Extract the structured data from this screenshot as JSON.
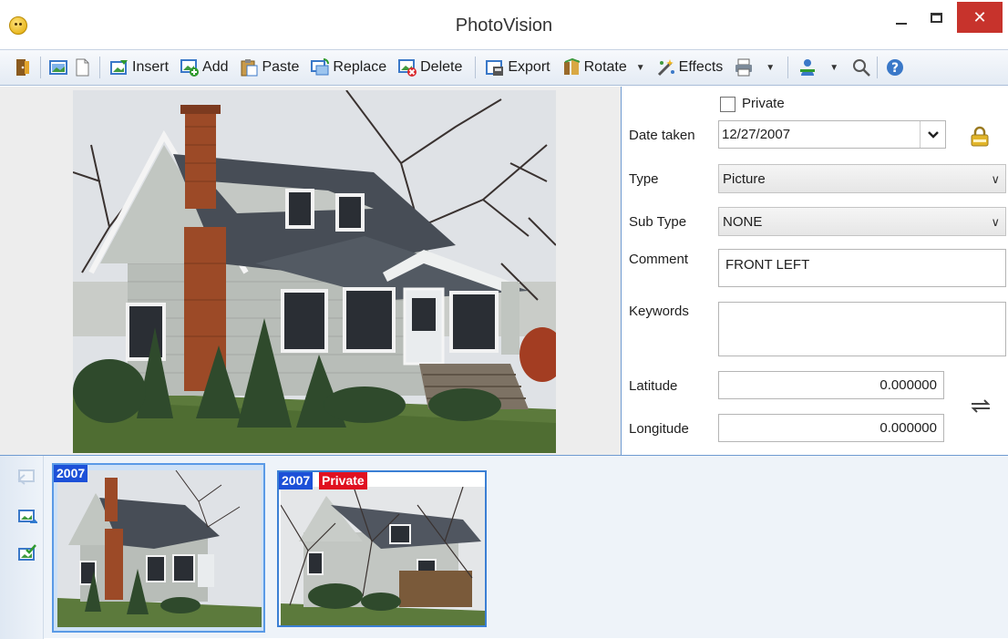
{
  "window": {
    "title": "PhotoVision",
    "close_glyph": "✕"
  },
  "toolbar": {
    "items": [
      {
        "icon": "exit-icon"
      },
      {
        "icon": "picture-icon"
      },
      {
        "icon": "page-icon"
      },
      {
        "label": "Insert",
        "icon": "insert-icon"
      },
      {
        "label": "Add",
        "icon": "add-icon"
      },
      {
        "label": "Paste",
        "icon": "paste-icon"
      },
      {
        "label": "Replace",
        "icon": "replace-icon"
      },
      {
        "label": "Delete",
        "icon": "delete-icon"
      },
      {
        "label": "Export",
        "icon": "export-icon"
      },
      {
        "label": "Rotate",
        "icon": "rotate-icon"
      },
      {
        "label": "Effects",
        "icon": "effects-icon"
      },
      {
        "icon": "print-icon"
      },
      {
        "icon": "users-icon"
      },
      {
        "icon": "search-icon"
      },
      {
        "icon": "help-icon"
      }
    ],
    "insert": "Insert",
    "add": "Add",
    "paste": "Paste",
    "replace": "Replace",
    "delete": "Delete",
    "export": "Export",
    "rotate": "Rotate",
    "effects": "Effects",
    "dropdown_glyph": "▼"
  },
  "properties": {
    "private_label": "Private",
    "private_checked": false,
    "date_taken_label": "Date taken",
    "date_taken_value": "12/27/2007",
    "type_label": "Type",
    "type_value": "Picture",
    "subtype_label": "Sub Type",
    "subtype_value": "NONE",
    "comment_label": "Comment",
    "comment_value": "FRONT LEFT",
    "keywords_label": "Keywords",
    "keywords_value": "",
    "latitude_label": "Latitude",
    "latitude_value": "0.000000",
    "longitude_label": "Longitude",
    "longitude_value": "0.000000",
    "combo_arrow": "∨",
    "date_arrow": "⌄"
  },
  "thumbnails": [
    {
      "year": "2007",
      "private": "",
      "selected": true
    },
    {
      "year": "2007",
      "private": "Private",
      "selected": false
    }
  ],
  "colors": {
    "accent": "#3b7fd4",
    "year_badge": "#1c50d8",
    "private_badge": "#e01020",
    "close_button": "#c7332c"
  }
}
